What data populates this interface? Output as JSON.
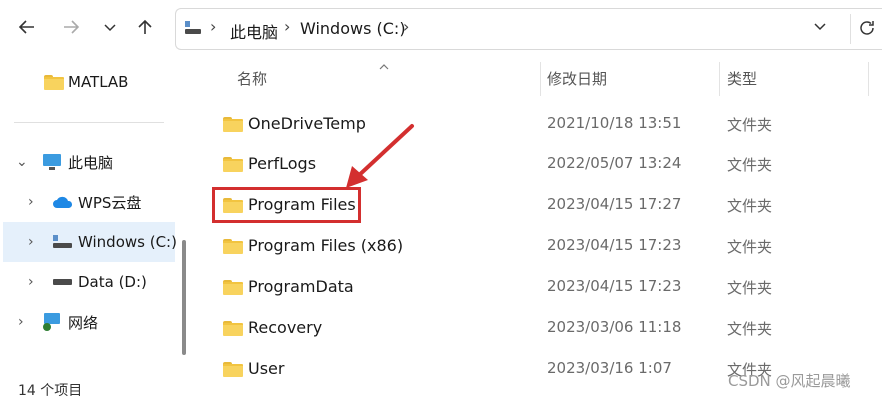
{
  "toolbar": {
    "back_icon": "arrow-left-icon",
    "forward_icon": "arrow-right-icon",
    "recent_icon": "chevron-down-icon",
    "up_icon": "arrow-up-icon"
  },
  "address": {
    "crumbs": [
      "此电脑",
      "Windows (C:)"
    ],
    "drive_icon": "drive-icon",
    "dropdown_icon": "chevron-down-icon",
    "refresh_icon": "refresh-icon"
  },
  "sidebar": {
    "items": [
      {
        "label": "MATLAB",
        "icon": "folder-icon"
      },
      {
        "label": "此电脑",
        "icon": "monitor-icon",
        "expanded": true
      },
      {
        "label": "WPS云盘",
        "icon": "cloud-icon"
      },
      {
        "label": "Windows (C:)",
        "icon": "drive-icon",
        "selected": true
      },
      {
        "label": "Data (D:)",
        "icon": "drive-icon"
      },
      {
        "label": "网络",
        "icon": "network-icon"
      }
    ]
  },
  "columns": {
    "name": "名称",
    "modified": "修改日期",
    "type": "类型",
    "sort_icon": "sort-up-icon"
  },
  "files": [
    {
      "name": "OneDriveTemp",
      "date": "2021/10/18 13:51",
      "type": "文件夹"
    },
    {
      "name": "PerfLogs",
      "date": "2022/05/07 13:24",
      "type": "文件夹"
    },
    {
      "name": "Program Files",
      "date": "2023/04/15 17:27",
      "type": "文件夹"
    },
    {
      "name": "Program Files (x86)",
      "date": "2023/04/15 17:23",
      "type": "文件夹"
    },
    {
      "name": "ProgramData",
      "date": "2023/04/15 17:23",
      "type": "文件夹"
    },
    {
      "name": "Recovery",
      "date": "2023/03/06 11:18",
      "type": "文件夹"
    },
    {
      "name": "User",
      "date": "2023/03/16 1:07",
      "type": "文件夹"
    }
  ],
  "status": {
    "count": "14 个项目"
  },
  "watermark": "CSDN @风起晨曦",
  "colors": {
    "annotation": "#d32f2f",
    "folder": "#f8d35e",
    "selection": "#e5f0fb"
  }
}
